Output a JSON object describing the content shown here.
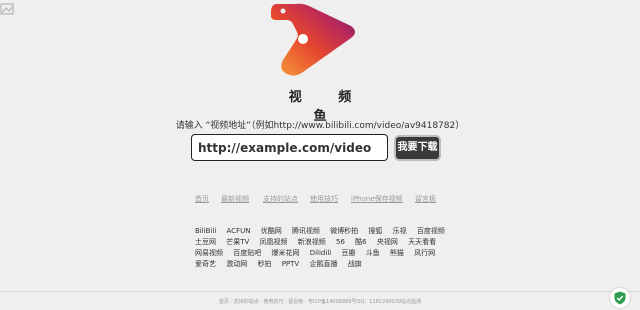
{
  "brand": {
    "title": "视 频 鱼"
  },
  "form": {
    "hint": "请输入 “视频地址”（例如http://www.bilibili.com/video/av9418782）",
    "placeholder": "http://example.com/video",
    "button_label": "我要下载"
  },
  "topnav": [
    "首页",
    "最新视频",
    "支持的站点",
    "使用技巧",
    "iPhone保存视频",
    "留言板"
  ],
  "sites": [
    "BiliBili",
    "ACFUN",
    "优酷网",
    "腾讯视频",
    "微博秒拍",
    "搜狐",
    "乐视",
    "百度视频",
    "土豆网",
    "芒果TV",
    "凤凰视频",
    "新浪视频",
    "56",
    "酷6",
    "央视网",
    "天天看看",
    "网易视频",
    "百度贴吧",
    "爆米花网",
    "Dilidili",
    "豆瓣",
    "斗鱼",
    "熊猫",
    "风行网",
    "爱奇艺",
    "激动网",
    "秒拍",
    "PPTV",
    "企鹅直播",
    "战旗"
  ],
  "footer": "首页 · 支持的站点 · 使用技巧 · 留言板 · 粤ICP备14008889号QQ：1182240039站点监测",
  "colors": {
    "accent": "#3a3a3a",
    "logo_start": "#f39c3a",
    "logo_end": "#6a1b6d"
  },
  "icons": {
    "corner": "image-placeholder-icon",
    "logo": "play-logo-icon",
    "shield": "shield-check-icon"
  }
}
